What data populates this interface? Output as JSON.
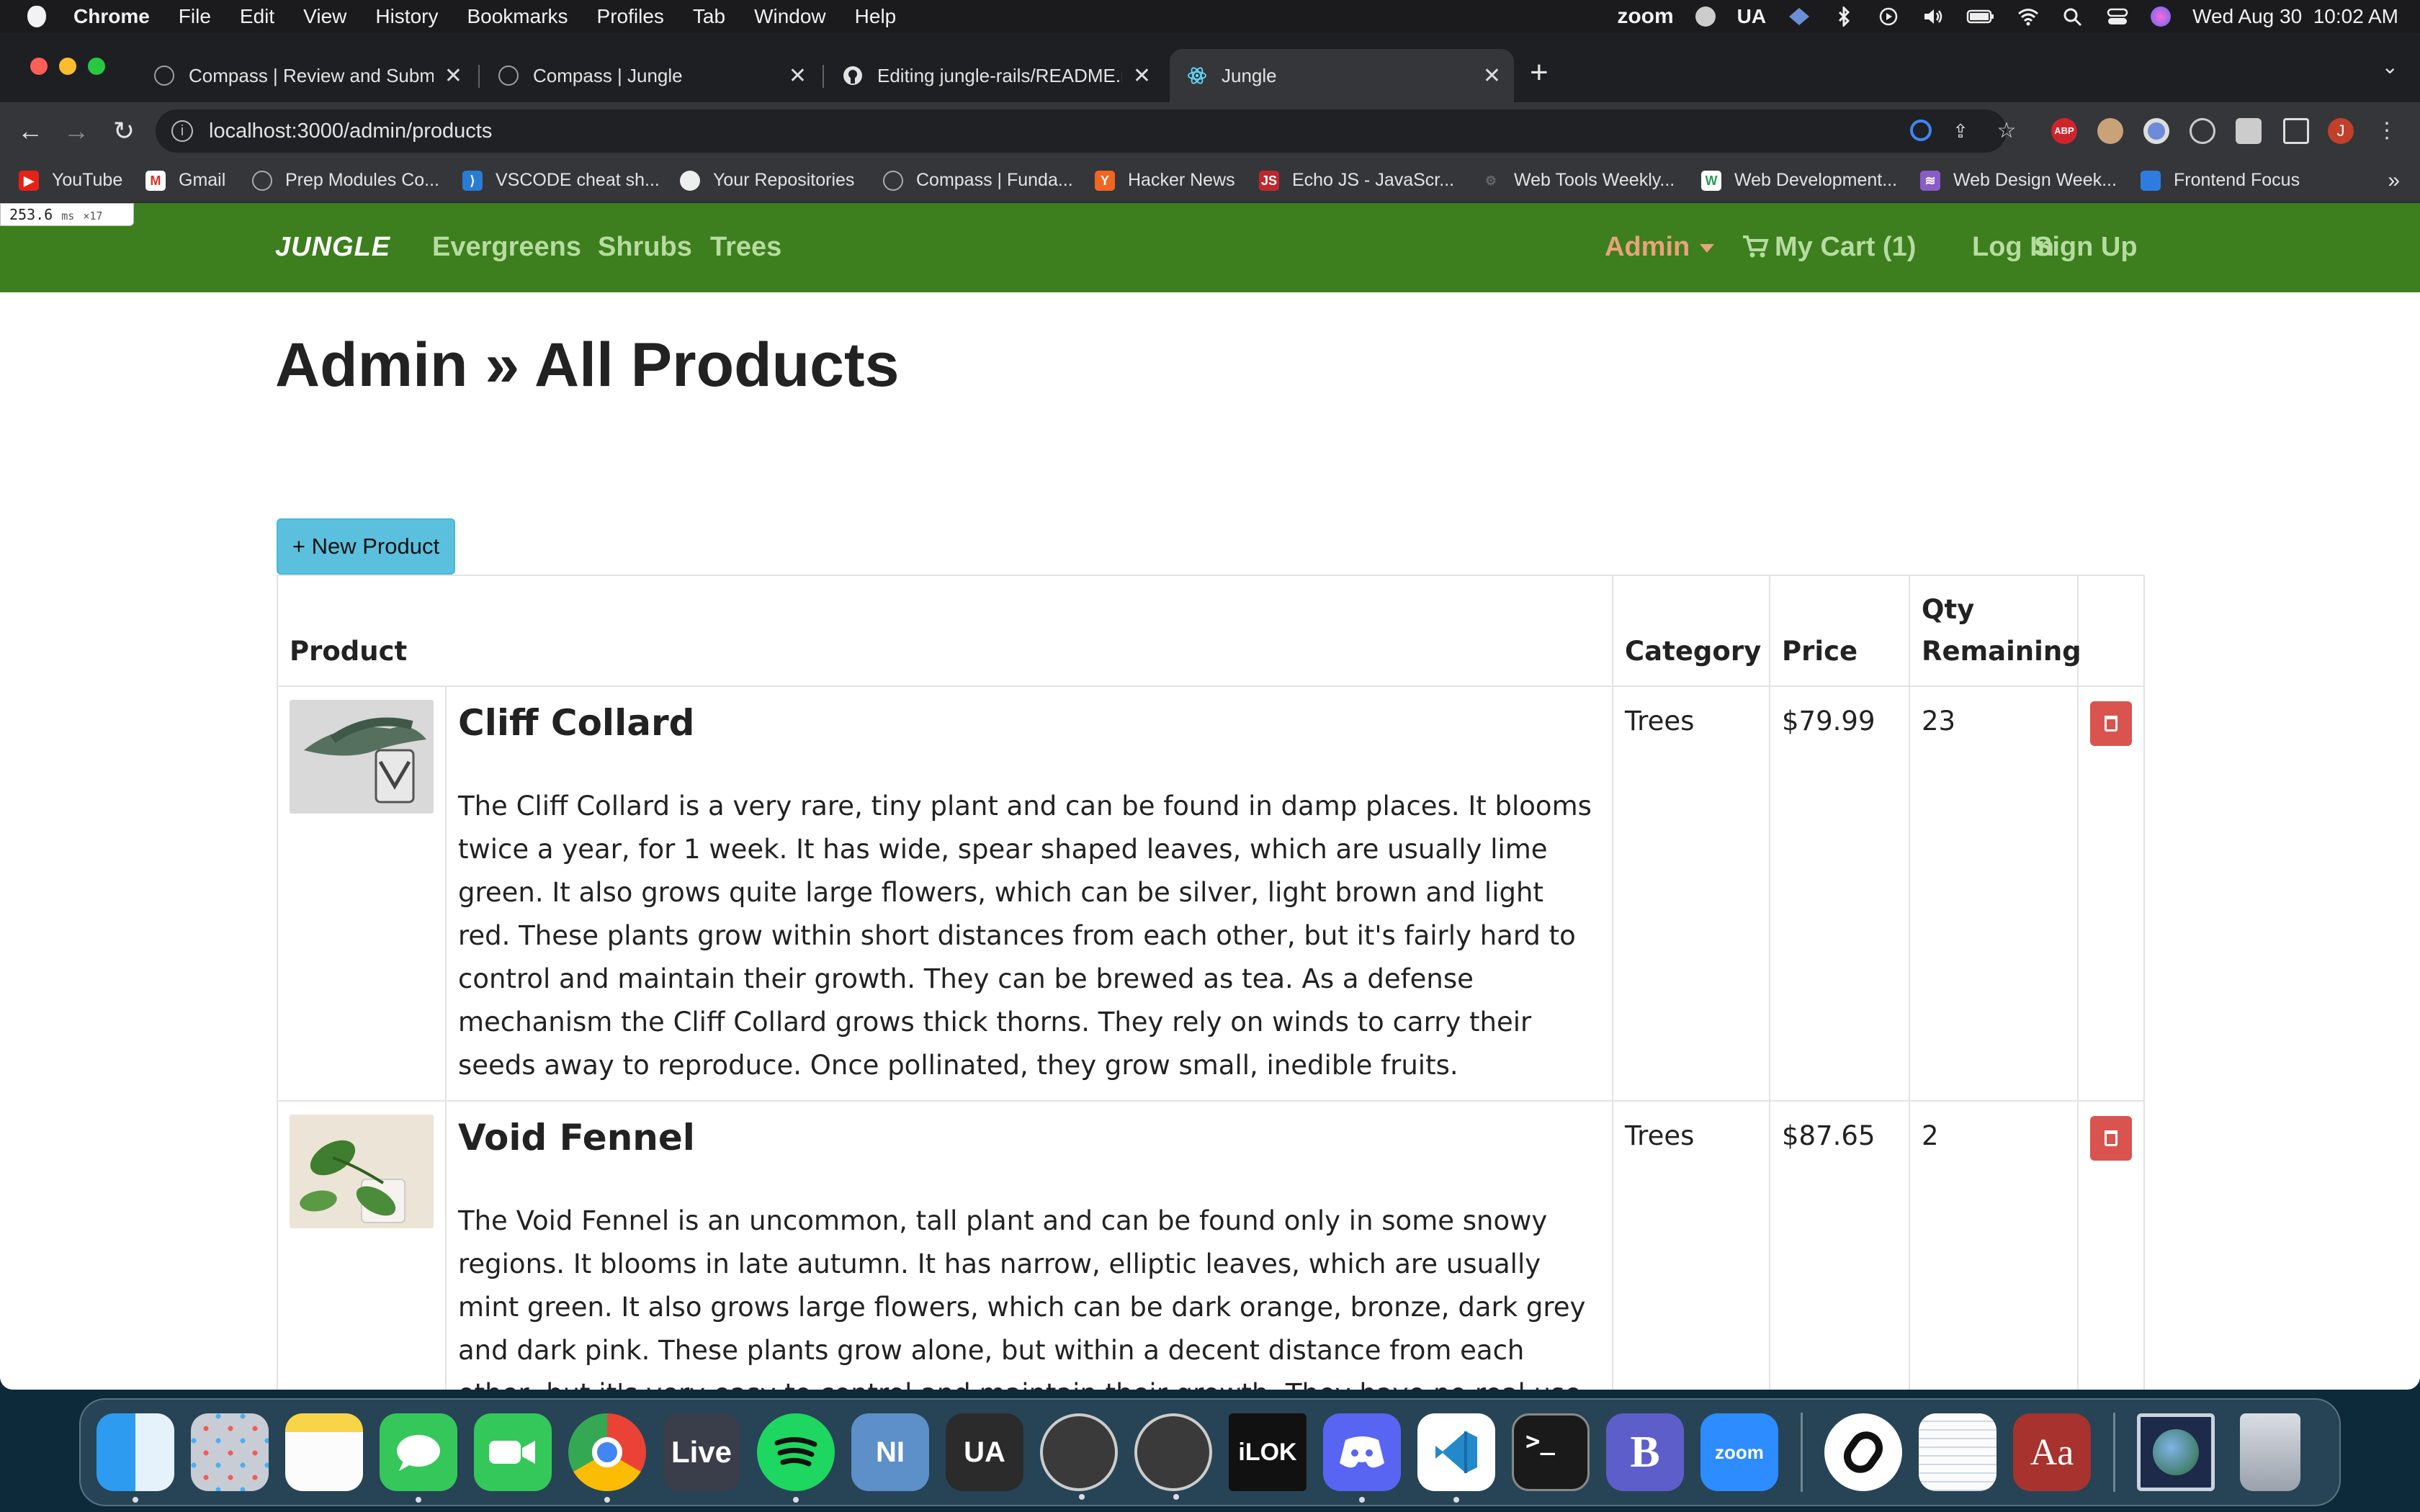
{
  "menubar": {
    "app": "Chrome",
    "items": [
      "File",
      "Edit",
      "View",
      "History",
      "Bookmarks",
      "Profiles",
      "Tab",
      "Window",
      "Help"
    ],
    "status": {
      "zoom": "zoom",
      "input": "UA",
      "datetime": "Wed Aug 30  10:02 AM"
    }
  },
  "browser": {
    "tabs": [
      {
        "label": "Compass | Review and Submit"
      },
      {
        "label": "Compass | Jungle"
      },
      {
        "label": "Editing jungle-rails/README.md"
      },
      {
        "label": "Jungle"
      }
    ],
    "url": "localhost:3000/admin/products",
    "bookmarks": [
      "YouTube",
      "Gmail",
      "Prep Modules Co...",
      "VSCODE cheat sh...",
      "Your Repositories",
      "Compass | Funda...",
      "Hacker News",
      "Echo JS - JavaScr...",
      "Web Tools Weekly...",
      "Web Development...",
      "Web Design Week...",
      "Frontend Focus"
    ],
    "profile_initial": "J"
  },
  "perf": {
    "value": "253.6",
    "unit": "ms",
    "mult": "×17"
  },
  "nav": {
    "brand": "JUNGLE",
    "links": [
      "Evergreens",
      "Shrubs",
      "Trees"
    ],
    "admin": "Admin",
    "cart": "My Cart (1)",
    "login": "Log In",
    "signup": "Sign Up"
  },
  "page": {
    "title": "Admin » All Products",
    "new_button": "+ New Product",
    "headers": {
      "product": "Product",
      "category": "Category",
      "price": "Price",
      "qty": "Qty Remaining"
    }
  },
  "products": [
    {
      "name": "Cliff Collard",
      "description": "The Cliff Collard is a very rare, tiny plant and can be found in damp places. It blooms twice a year, for 1 week. It has wide, spear shaped leaves, which are usually lime green. It also grows quite large flowers, which can be silver, light brown and light red. These plants grow within short distances from each other, but it's fairly hard to control and maintain their growth. They can be brewed as tea. As a defense mechanism the Cliff Collard grows thick thorns. They rely on winds to carry their seeds away to reproduce. Once pollinated, they grow small, inedible fruits.",
      "category": "Trees",
      "price": "$79.99",
      "qty": "23"
    },
    {
      "name": "Void Fennel",
      "description": "The Void Fennel is an uncommon, tall plant and can be found only in some snowy regions. It blooms in late autumn. It has narrow, elliptic leaves, which are usually mint green. It also grows large flowers, which can be dark orange, bronze, dark grey and dark pink. These plants grow alone, but within a decent distance from each other, but it's very easy to control and maintain their growth. They have no real use, besides their aesthetics. As a defense mechanism the Void",
      "category": "Trees",
      "price": "$87.65",
      "qty": "2"
    }
  ],
  "dock": {
    "apps": [
      "finder-icon",
      "launchpad-icon",
      "notes-icon",
      "messages-icon",
      "facetime-icon",
      "chrome-icon",
      "ableton-live-icon",
      "spotify-icon",
      "native-instruments-icon",
      "ua-connect-icon",
      "ua-console-icon",
      "ua-meter-icon",
      "ilok-icon",
      "discord-icon",
      "vscode-icon",
      "terminal-icon",
      "bbedit-icon",
      "zoom-icon",
      "superstar-icon",
      "textedit-icon",
      "dictionary-icon",
      "downloads-icon",
      "trash-icon"
    ],
    "labels": {
      "live": "Live",
      "ni": "NI",
      "ua": "UA",
      "ilok": "iLOK",
      "zoom": "zoom",
      "bbedit": "B",
      "dictionary": "Aa",
      "terminal": ">_"
    }
  }
}
